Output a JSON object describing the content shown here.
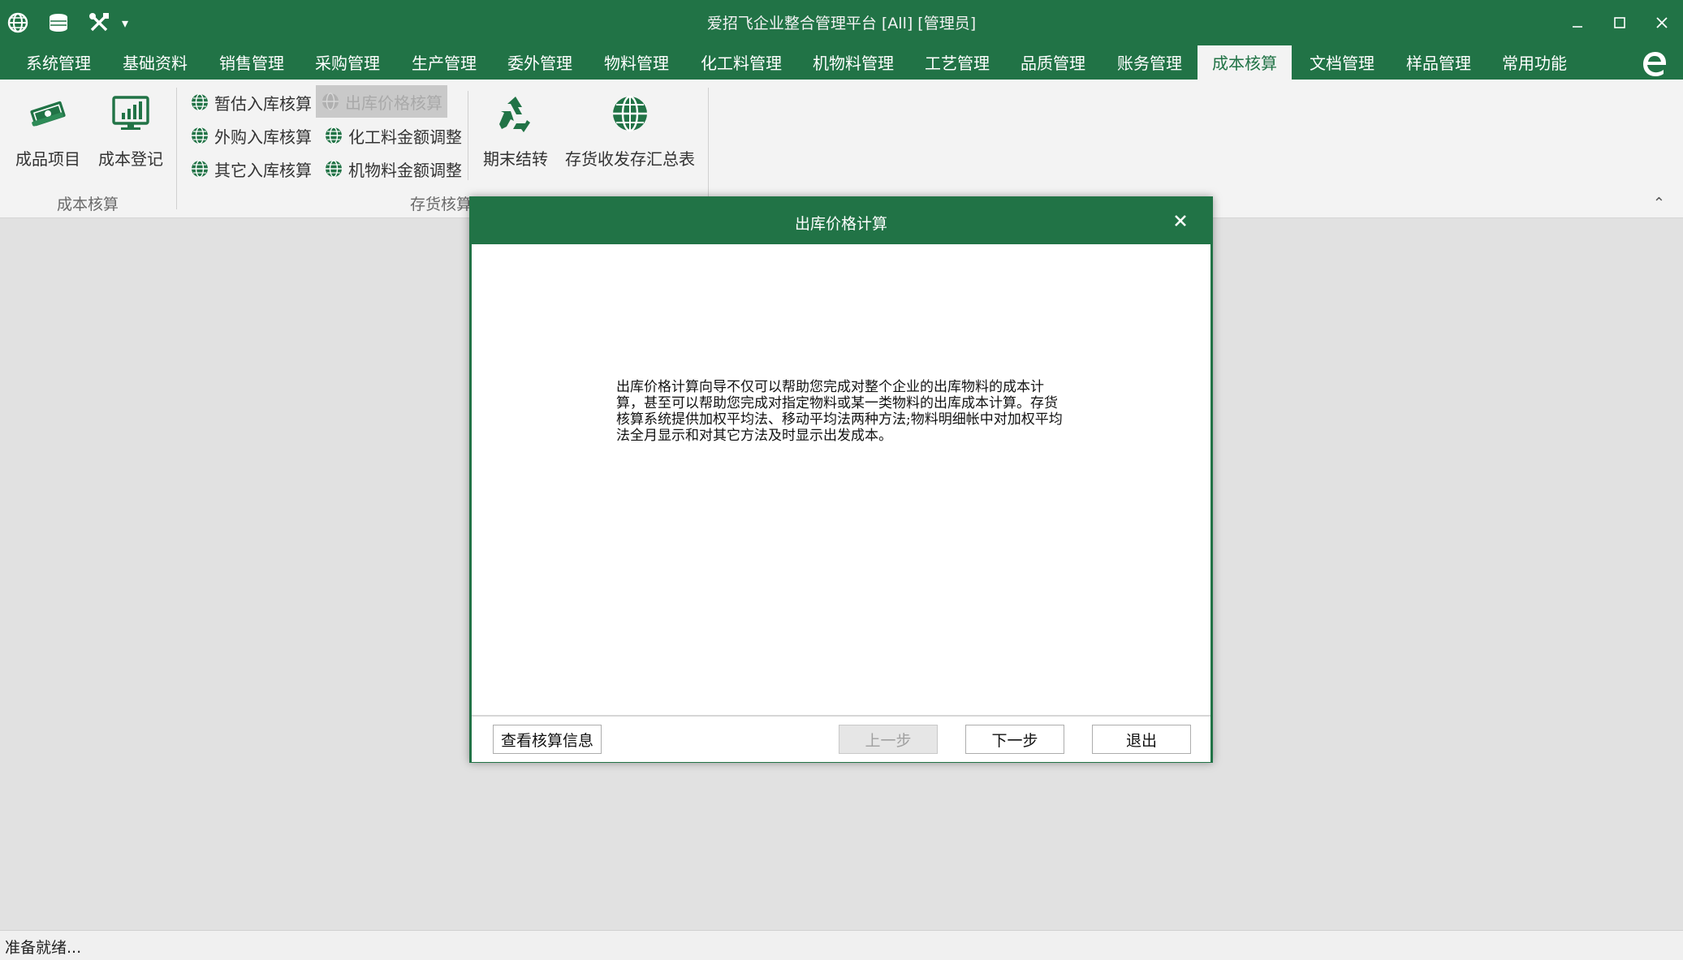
{
  "app": {
    "title": "爱招飞企业整合管理平台 [All] [管理员]",
    "accent_color": "#217346",
    "quick_access_icons": [
      "globe-icon",
      "database-icon",
      "tools-icon",
      "dropdown-arrow-icon"
    ],
    "quick_access_dropdown": "▾"
  },
  "window_controls": [
    "minimize-icon",
    "maximize-icon",
    "close-icon"
  ],
  "menu": {
    "tabs": [
      {
        "label": "系统管理"
      },
      {
        "label": "基础资料"
      },
      {
        "label": "销售管理"
      },
      {
        "label": "采购管理"
      },
      {
        "label": "生产管理"
      },
      {
        "label": "委外管理"
      },
      {
        "label": "物料管理"
      },
      {
        "label": "化工料管理"
      },
      {
        "label": "机物料管理"
      },
      {
        "label": "工艺管理"
      },
      {
        "label": "品质管理"
      },
      {
        "label": "账务管理"
      },
      {
        "label": "成本核算"
      },
      {
        "label": "文档管理"
      },
      {
        "label": "样品管理"
      },
      {
        "label": "常用功能"
      }
    ],
    "active_tab": "成本核算"
  },
  "ribbon": {
    "group1": {
      "label": "成本核算",
      "buttons": [
        {
          "label": "成品项目",
          "icon": "money-stack-icon"
        },
        {
          "label": "成本登记",
          "icon": "bar-chart-monitor-icon"
        }
      ]
    },
    "group2": {
      "label": "存货核算",
      "small_buttons": [
        {
          "label": "暂估入库核算",
          "icon": "globe-icon"
        },
        {
          "label": "外购入库核算",
          "icon": "globe-icon"
        },
        {
          "label": "其它入库核算",
          "icon": "globe-icon"
        },
        {
          "label": "出库价格核算",
          "icon": "globe-icon",
          "state": "disabled"
        },
        {
          "label": "化工料金额调整",
          "icon": "globe-icon"
        },
        {
          "label": "机物料金额调整",
          "icon": "globe-icon"
        }
      ],
      "big_buttons": [
        {
          "label": "期末结转",
          "icon": "recycle-icon"
        },
        {
          "label": "存货收发存汇总表",
          "icon": "globe-icon"
        }
      ]
    },
    "collapse_glyph": "⌃"
  },
  "dialog": {
    "title": "出库价格计算",
    "close_glyph": "✕",
    "description": "出库价格计算向导不仅可以帮助您完成对整个企业的出库物料的成本计算，甚至可以帮助您完成对指定物料或某一类物料的出库成本计算。存货核算系统提供加权平均法、移动平均法两种方法;物料明细帐中对加权平均法全月显示和对其它方法及时显示出发成本。",
    "buttons": {
      "view_info": "查看核算信息",
      "prev": "上一步",
      "next": "下一步",
      "exit": "退出"
    }
  },
  "status": {
    "text": "准备就绪..."
  }
}
